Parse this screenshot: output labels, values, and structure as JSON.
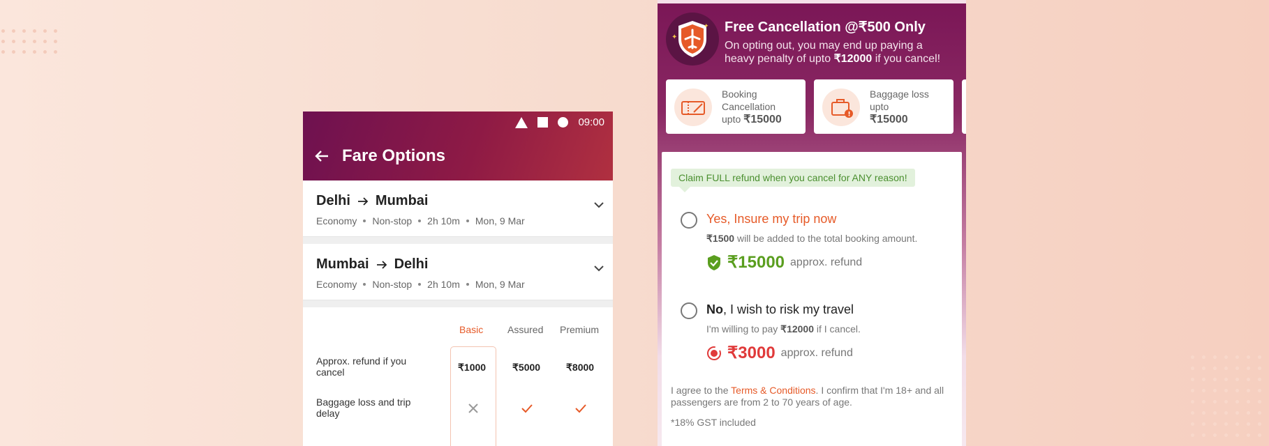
{
  "left_phone": {
    "status_time": "09:00",
    "title": "Fare Options",
    "routes": [
      {
        "from": "Delhi",
        "to": "Mumbai",
        "meta": [
          "Economy",
          "Non-stop",
          "2h 10m",
          "Mon, 9 Mar"
        ]
      },
      {
        "from": "Mumbai",
        "to": "Delhi",
        "meta": [
          "Economy",
          "Non-stop",
          "2h 10m",
          "Mon, 9 Mar"
        ]
      }
    ],
    "fare_table": {
      "columns": [
        "Basic",
        "Assured",
        "Premium"
      ],
      "rows": [
        {
          "label": "Approx. refund if you cancel",
          "values": [
            "₹1000",
            "₹5000",
            "₹8000"
          ]
        },
        {
          "label": "Baggage loss and trip delay",
          "values": [
            "cross",
            "check",
            "check"
          ]
        }
      ]
    }
  },
  "right_phone": {
    "heading": "Free Cancellation @₹500 Only",
    "subheading_1": "On opting out, you may end up paying a",
    "subheading_2a": "heavy penalty of upto",
    "subheading_amount": "₹12000",
    "subheading_2b": "if you cancel!",
    "cards": [
      {
        "line1": "Booking",
        "line2": "Cancellation",
        "line3": "upto",
        "amount": "₹15000"
      },
      {
        "line1": "Baggage loss",
        "line2": "upto",
        "amount": "₹15000"
      }
    ],
    "claim_text": "Claim FULL refund when you cancel for ANY reason!",
    "option_yes": {
      "title": "Yes, Insure my trip now",
      "sub_amount": "₹1500",
      "sub_text": "will be added to the total booking amount.",
      "refund": "₹15000",
      "refund_label": "approx. refund"
    },
    "option_no": {
      "title_bold": "No",
      "title_rest": ", I wish to risk my travel",
      "sub_text_a": "I'm willing to pay",
      "sub_amount": "₹12000",
      "sub_text_b": "if I cancel.",
      "refund": "₹3000",
      "refund_label": "approx. refund"
    },
    "terms_a": "I agree to the",
    "terms_link": "Terms & Conditions",
    "terms_b": ". I confirm that I'm 18+ and all passengers are from 2 to 70 years of age.",
    "gst": "*18% GST included"
  },
  "colors": {
    "accent": "#e65a28",
    "green": "#5a9e1f",
    "red": "#e03a3a",
    "brand": "#7a1656"
  }
}
